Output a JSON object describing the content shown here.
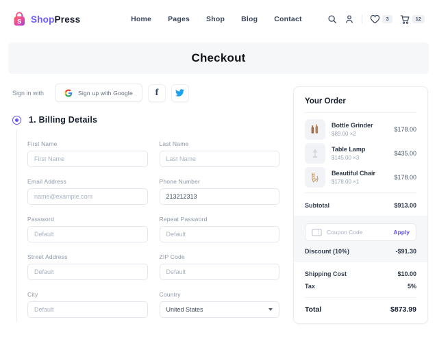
{
  "header": {
    "brand": {
      "shop": "Shop",
      "press": "Press"
    },
    "nav": [
      "Home",
      "Pages",
      "Shop",
      "Blog",
      "Contact"
    ],
    "wishlist_count": "3",
    "cart_count": "12"
  },
  "banner": {
    "title": "Checkout"
  },
  "signin": {
    "label": "Sign in with",
    "google_label": "Sign up with Google"
  },
  "billing": {
    "heading": "1. Billing Details",
    "fields": [
      {
        "label": "First Name",
        "placeholder": "First Name"
      },
      {
        "label": "Last Name",
        "placeholder": "Last Name"
      },
      {
        "label": "Email Address",
        "placeholder": "name@example.com"
      },
      {
        "label": "Phone Number",
        "value": "213212313"
      },
      {
        "label": "Password",
        "placeholder": "Default"
      },
      {
        "label": "Repeat Password",
        "placeholder": "Default"
      },
      {
        "label": "Street Address",
        "placeholder": "Default"
      },
      {
        "label": "ZIP Code",
        "placeholder": "Default"
      },
      {
        "label": "City",
        "placeholder": "Default"
      },
      {
        "label": "Country",
        "value": "United States"
      }
    ]
  },
  "order": {
    "title": "Your Order",
    "items": [
      {
        "name": "Bottle Grinder",
        "unit": "$89.00 ×2",
        "total": "$178.00"
      },
      {
        "name": "Table Lamp",
        "unit": "$145.00 ×3",
        "total": "$435.00"
      },
      {
        "name": "Beautiful Chair",
        "unit": "$178.00 ×1",
        "total": "$178.00"
      }
    ],
    "subtotal_label": "Subtotal",
    "subtotal_value": "$913.00",
    "coupon": {
      "placeholder": "Coupon Code",
      "apply_label": "Apply",
      "discount_label": "Discount (10%)",
      "discount_value": "-$91.30"
    },
    "shipping_label": "Shipping Cost",
    "shipping_value": "$10.00",
    "tax_label": "Tax",
    "tax_value": "5%",
    "total_label": "Total",
    "total_value": "$873.99"
  },
  "colors": {
    "accent": "#6153f0",
    "brand_purple": "#6a5af9",
    "twitter_blue": "#1da1f2",
    "facebook_navy": "#2b3f66",
    "banner_bg": "#f6f7f9",
    "badge_bg": "#eef0f4"
  }
}
